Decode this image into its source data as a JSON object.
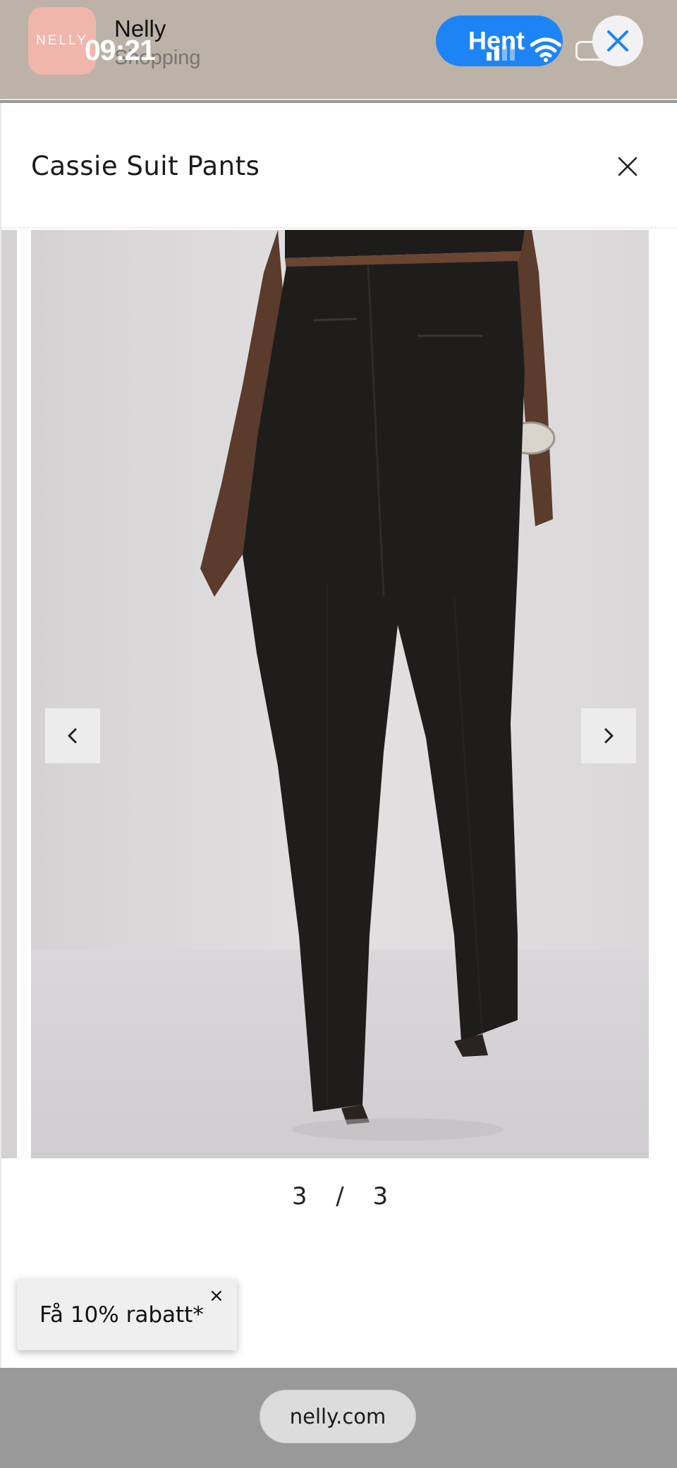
{
  "banner": {
    "logo_text": "NELLY",
    "app_name": "Nelly",
    "app_subtitle": "Shopping",
    "get_label": "Hent",
    "close_icon": "close-icon"
  },
  "status_bar": {
    "time": "09:21"
  },
  "product": {
    "title": "Cassie Suit Pants"
  },
  "gallery": {
    "current": "3",
    "separator": "/",
    "total": "3",
    "prev_icon": "chevron-left-icon",
    "next_icon": "chevron-right-icon"
  },
  "discount": {
    "label": "Få 10% rabatt*",
    "close": "×"
  },
  "browser": {
    "url": "nelly.com"
  },
  "colors": {
    "accent": "#1d84f5",
    "banner_bg": "#bcb2a8",
    "logo_bg": "#f1b6ab"
  }
}
